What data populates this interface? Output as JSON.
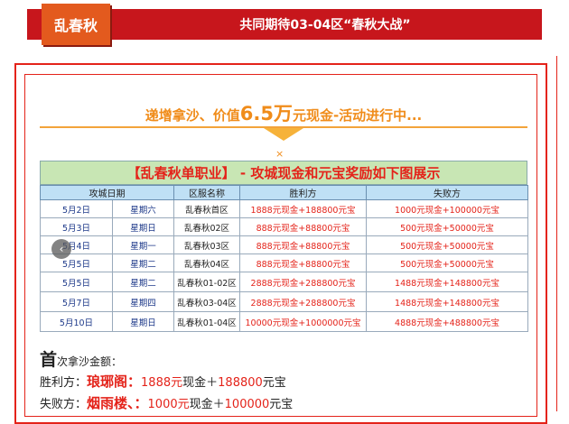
{
  "header": {
    "badge": "乱春秋",
    "title": "共同期待03-04区“春秋大战”"
  },
  "headline": {
    "part1": "递增拿沙、价值",
    "big": "6.5万",
    "part2": "元现金-活动进行中..."
  },
  "decor": {
    "x_mark": "×"
  },
  "table": {
    "title": "【乱春秋单职业】 - 攻城现金和元宝奖励如下图展示",
    "headers": [
      "攻城日期",
      "",
      "区服名称",
      "胜利方",
      "失败方"
    ],
    "rows": [
      {
        "date": "5月2日",
        "weekday": "星期六",
        "server": "乱春秋首区",
        "win": "1888元现金+188800元宝",
        "lose": "1000元现金+100000元宝"
      },
      {
        "date": "5月3日",
        "weekday": "星期日",
        "server": "乱春秋02区",
        "win": "888元现金+88800元宝",
        "lose": "500元现金+50000元宝"
      },
      {
        "date": "5月4日",
        "weekday": "星期一",
        "server": "乱春秋03区",
        "win": "888元现金+88800元宝",
        "lose": "500元现金+50000元宝"
      },
      {
        "date": "5月5日",
        "weekday": "星期二",
        "server": "乱春秋04区",
        "win": "888元现金+88800元宝",
        "lose": "500元现金+50000元宝"
      },
      {
        "date": "5月5日",
        "weekday": "星期二",
        "server": "乱春秋01-02区",
        "win": "2888元现金+288800元宝",
        "lose": "1488元现金+148800元宝"
      },
      {
        "date": "5月7日",
        "weekday": "星期四",
        "server": "乱春秋03-04区",
        "win": "2888元现金+288800元宝",
        "lose": "1488元现金+148800元宝"
      },
      {
        "date": "5月10日",
        "weekday": "星期日",
        "server": "乱春秋01-04区",
        "win": "10000元现金+1000000元宝",
        "lose": "4888元现金+488800元宝"
      }
    ]
  },
  "nav": {
    "prev_icon": "‹"
  },
  "bottom": {
    "first_big": "首",
    "first_rest": "次拿沙金额：",
    "win_label": "胜利方：",
    "win_guild": "琅琊阁：",
    "win_cash": "1888元",
    "win_cash_unit": "现金",
    "win_plus": "＋",
    "win_ingot": "188800",
    "win_ingot_unit": "元宝",
    "lose_label": "失败方：",
    "lose_guild": "烟雨楼、：",
    "lose_cash": "1000元",
    "lose_cash_unit": "现金",
    "lose_plus": "＋",
    "lose_ingot": "100000",
    "lose_ingot_unit": "元宝"
  }
}
